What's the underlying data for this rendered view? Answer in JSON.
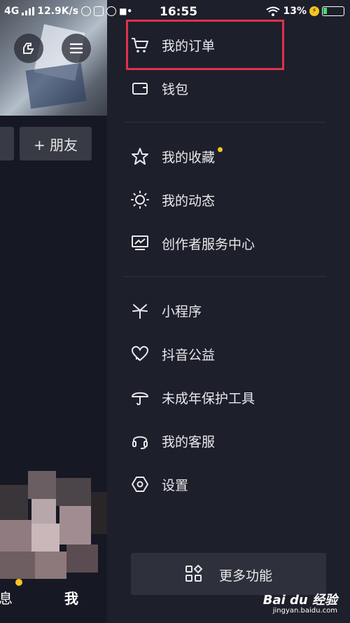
{
  "status_bar": {
    "network": "4G",
    "speed": "12.9K/s",
    "time": "16:55",
    "battery_percent": "13%"
  },
  "profile_background": {
    "add_friend_label": "+ 朋友",
    "tabs": {
      "messages_partial": "息",
      "me": "我"
    }
  },
  "drawer": {
    "items": [
      {
        "label": "我的订单",
        "icon": "cart-icon"
      },
      {
        "label": "钱包",
        "icon": "wallet-icon"
      },
      {
        "label": "我的收藏",
        "icon": "star-icon",
        "badge": true
      },
      {
        "label": "我的动态",
        "icon": "sun-icon"
      },
      {
        "label": "创作者服务中心",
        "icon": "chart-monitor-icon"
      },
      {
        "label": "小程序",
        "icon": "miniapp-icon"
      },
      {
        "label": "抖音公益",
        "icon": "heart-icon"
      },
      {
        "label": "未成年保护工具",
        "icon": "umbrella-icon"
      },
      {
        "label": "我的客服",
        "icon": "headset-icon"
      },
      {
        "label": "设置",
        "icon": "hexagon-gear-icon"
      }
    ],
    "more_button_label": "更多功能",
    "more_button_icon": "grid-icon"
  },
  "watermark": {
    "brand": "Bai du 经验",
    "url": "jingyan.baidu.com"
  },
  "colors": {
    "drawer_bg": "#1d1f2b",
    "page_bg": "#161823",
    "highlight": "#e0314a",
    "badge": "#f7c51e"
  }
}
